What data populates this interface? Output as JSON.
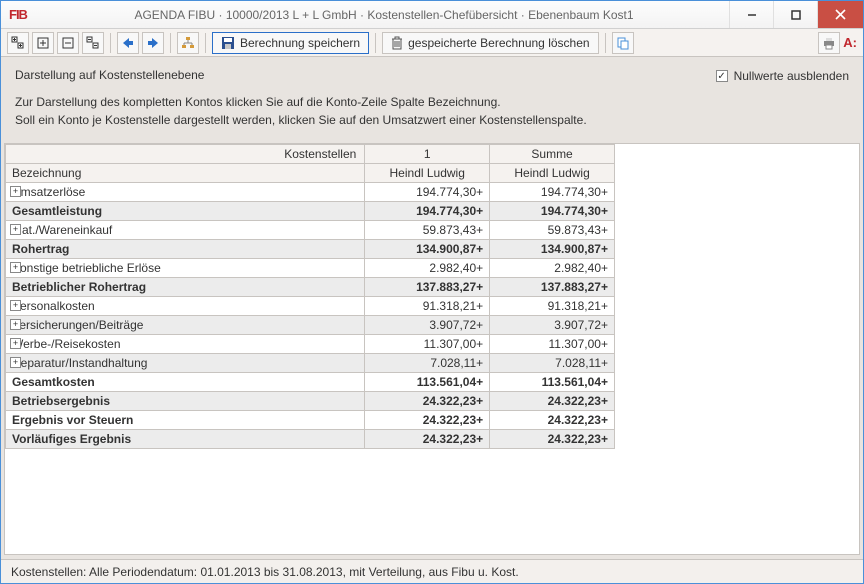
{
  "window": {
    "app_icon": "FIB",
    "title": "AGENDA FIBU · 10000/2013 L + L GmbH · Kostenstellen-Chefübersicht · Ebenenbaum Kost1"
  },
  "toolbar": {
    "save_label": "Berechnung speichern",
    "delete_label": "gespeicherte Berechnung löschen",
    "ax_label": "A:"
  },
  "info": {
    "heading": "Darstellung auf Kostenstellenebene",
    "line1": "Zur Darstellung des kompletten Kontos klicken Sie auf die Konto-Zeile Spalte Bezeichnung.",
    "line2": "Soll ein Konto je Kostenstelle dargestellt werden, klicken Sie auf den Umsatzwert einer Kostenstellenspalte.",
    "nullwerte_label": "Nullwerte ausblenden"
  },
  "grid": {
    "header_row1": {
      "c1": "Kostenstellen",
      "c2": "1",
      "c3": "Summe"
    },
    "header_row2": {
      "c1": "Bezeichnung",
      "c2": "Heindl Ludwig",
      "c3": "Heindl Ludwig"
    },
    "rows": [
      {
        "label": "Umsatzerlöse",
        "v1": "194.774,30+",
        "v2": "194.774,30+",
        "exp": true,
        "bold": false,
        "shade": false
      },
      {
        "label": "Gesamtleistung",
        "v1": "194.774,30+",
        "v2": "194.774,30+",
        "exp": false,
        "bold": true,
        "shade": true
      },
      {
        "label": "Mat./Wareneinkauf",
        "v1": "59.873,43+",
        "v2": "59.873,43+",
        "exp": true,
        "bold": false,
        "shade": false
      },
      {
        "label": "Rohertrag",
        "v1": "134.900,87+",
        "v2": "134.900,87+",
        "exp": false,
        "bold": true,
        "shade": true
      },
      {
        "label": "Sonstige betriebliche Erlöse",
        "v1": "2.982,40+",
        "v2": "2.982,40+",
        "exp": true,
        "bold": false,
        "shade": false
      },
      {
        "label": "Betrieblicher Rohertrag",
        "v1": "137.883,27+",
        "v2": "137.883,27+",
        "exp": false,
        "bold": true,
        "shade": true
      },
      {
        "label": "Personalkosten",
        "v1": "91.318,21+",
        "v2": "91.318,21+",
        "exp": true,
        "bold": false,
        "shade": false
      },
      {
        "label": "Versicherungen/Beiträge",
        "v1": "3.907,72+",
        "v2": "3.907,72+",
        "exp": true,
        "bold": false,
        "shade": true
      },
      {
        "label": "Werbe-/Reisekosten",
        "v1": "11.307,00+",
        "v2": "11.307,00+",
        "exp": true,
        "bold": false,
        "shade": false
      },
      {
        "label": "Reparatur/Instandhaltung",
        "v1": "7.028,11+",
        "v2": "7.028,11+",
        "exp": true,
        "bold": false,
        "shade": true
      },
      {
        "label": "Gesamtkosten",
        "v1": "113.561,04+",
        "v2": "113.561,04+",
        "exp": false,
        "bold": true,
        "shade": false
      },
      {
        "label": "Betriebsergebnis",
        "v1": "24.322,23+",
        "v2": "24.322,23+",
        "exp": false,
        "bold": true,
        "shade": true
      },
      {
        "label": "Ergebnis vor Steuern",
        "v1": "24.322,23+",
        "v2": "24.322,23+",
        "exp": false,
        "bold": true,
        "shade": false
      },
      {
        "label": "Vorläufiges Ergebnis",
        "v1": "24.322,23+",
        "v2": "24.322,23+",
        "exp": false,
        "bold": true,
        "shade": true
      }
    ]
  },
  "statusbar": {
    "text": "Kostenstellen: Alle  Periodendatum: 01.01.2013 bis 31.08.2013, mit Verteilung, aus Fibu u. Kost."
  }
}
